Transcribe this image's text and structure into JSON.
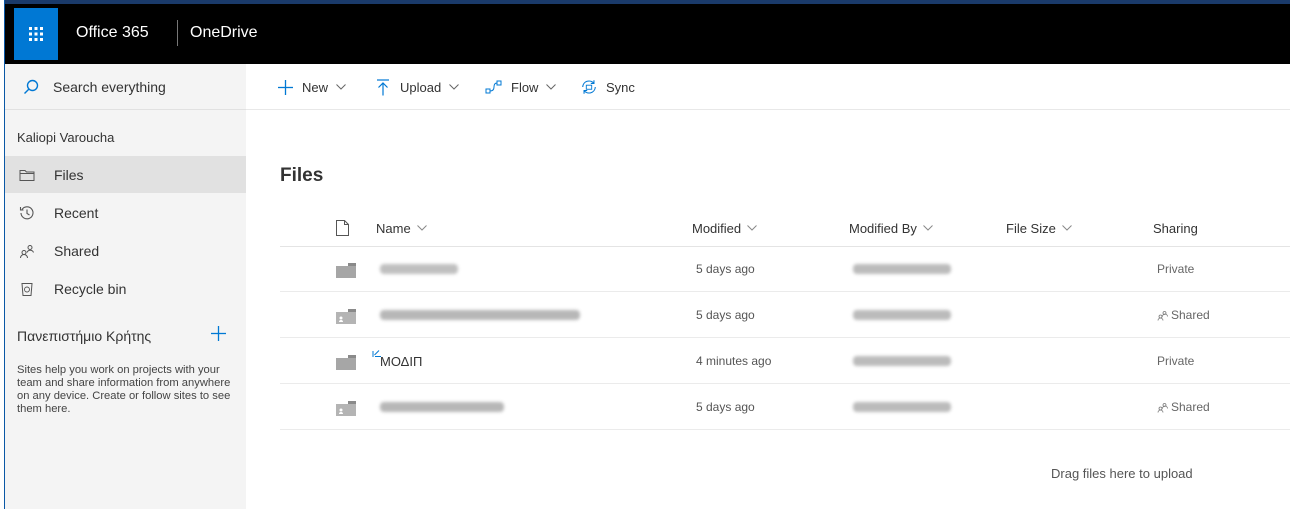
{
  "topbar": {
    "suite_title": "Office 365",
    "app_title": "OneDrive",
    "waffle_icon": "app-launcher-icon"
  },
  "search": {
    "label": "Search everything",
    "icon": "search-icon"
  },
  "nav": {
    "owner": "Kaliopi Varoucha",
    "items": [
      {
        "label": "Files",
        "icon": "folder-icon",
        "active": true
      },
      {
        "label": "Recent",
        "icon": "clock-icon"
      },
      {
        "label": "Shared",
        "icon": "shared-people-icon"
      },
      {
        "label": "Recycle bin",
        "icon": "recycle-bin-icon"
      }
    ],
    "sites_heading": "Πανεπιστήμιο Κρήτης",
    "sites_help": "Sites help you work on projects with your team and share information from anywhere on any device. Create or follow sites to see them here."
  },
  "commands": [
    {
      "label": "New",
      "icon": "plus-icon",
      "dropdown": true
    },
    {
      "label": "Upload",
      "icon": "upload-arrow-icon",
      "dropdown": true
    },
    {
      "label": "Flow",
      "icon": "flow-icon",
      "dropdown": true
    },
    {
      "label": "Sync",
      "icon": "sync-icon",
      "dropdown": false
    }
  ],
  "main": {
    "title": "Files",
    "columns": {
      "type_icon": "file-type-icon",
      "name": "Name",
      "modified": "Modified",
      "modified_by": "Modified By",
      "file_size": "File Size",
      "sharing": "Sharing"
    },
    "rows": [
      {
        "name": "",
        "name_obscured": true,
        "modified": "5 days ago",
        "sharing": "Private",
        "shared": false,
        "is_new": false
      },
      {
        "name": "",
        "name_obscured": true,
        "modified": "5 days ago",
        "sharing": "Shared",
        "shared": true,
        "is_new": false
      },
      {
        "name": "ΜΟΔΙΠ",
        "name_obscured": false,
        "modified": "4 minutes ago",
        "sharing": "Private",
        "shared": false,
        "is_new": true
      },
      {
        "name": "",
        "name_obscured": true,
        "modified": "5 days ago",
        "sharing": "Shared",
        "shared": true,
        "is_new": false
      }
    ],
    "dropzone": "Drag files here to upload"
  },
  "colors": {
    "topbar_bg": "#000000",
    "waffle_bg": "#0078d4",
    "accent": "#0078d4",
    "nav_bg": "#f4f4f4",
    "nav_active_bg": "#e1e1e1",
    "folder": "#a6a6a6"
  }
}
